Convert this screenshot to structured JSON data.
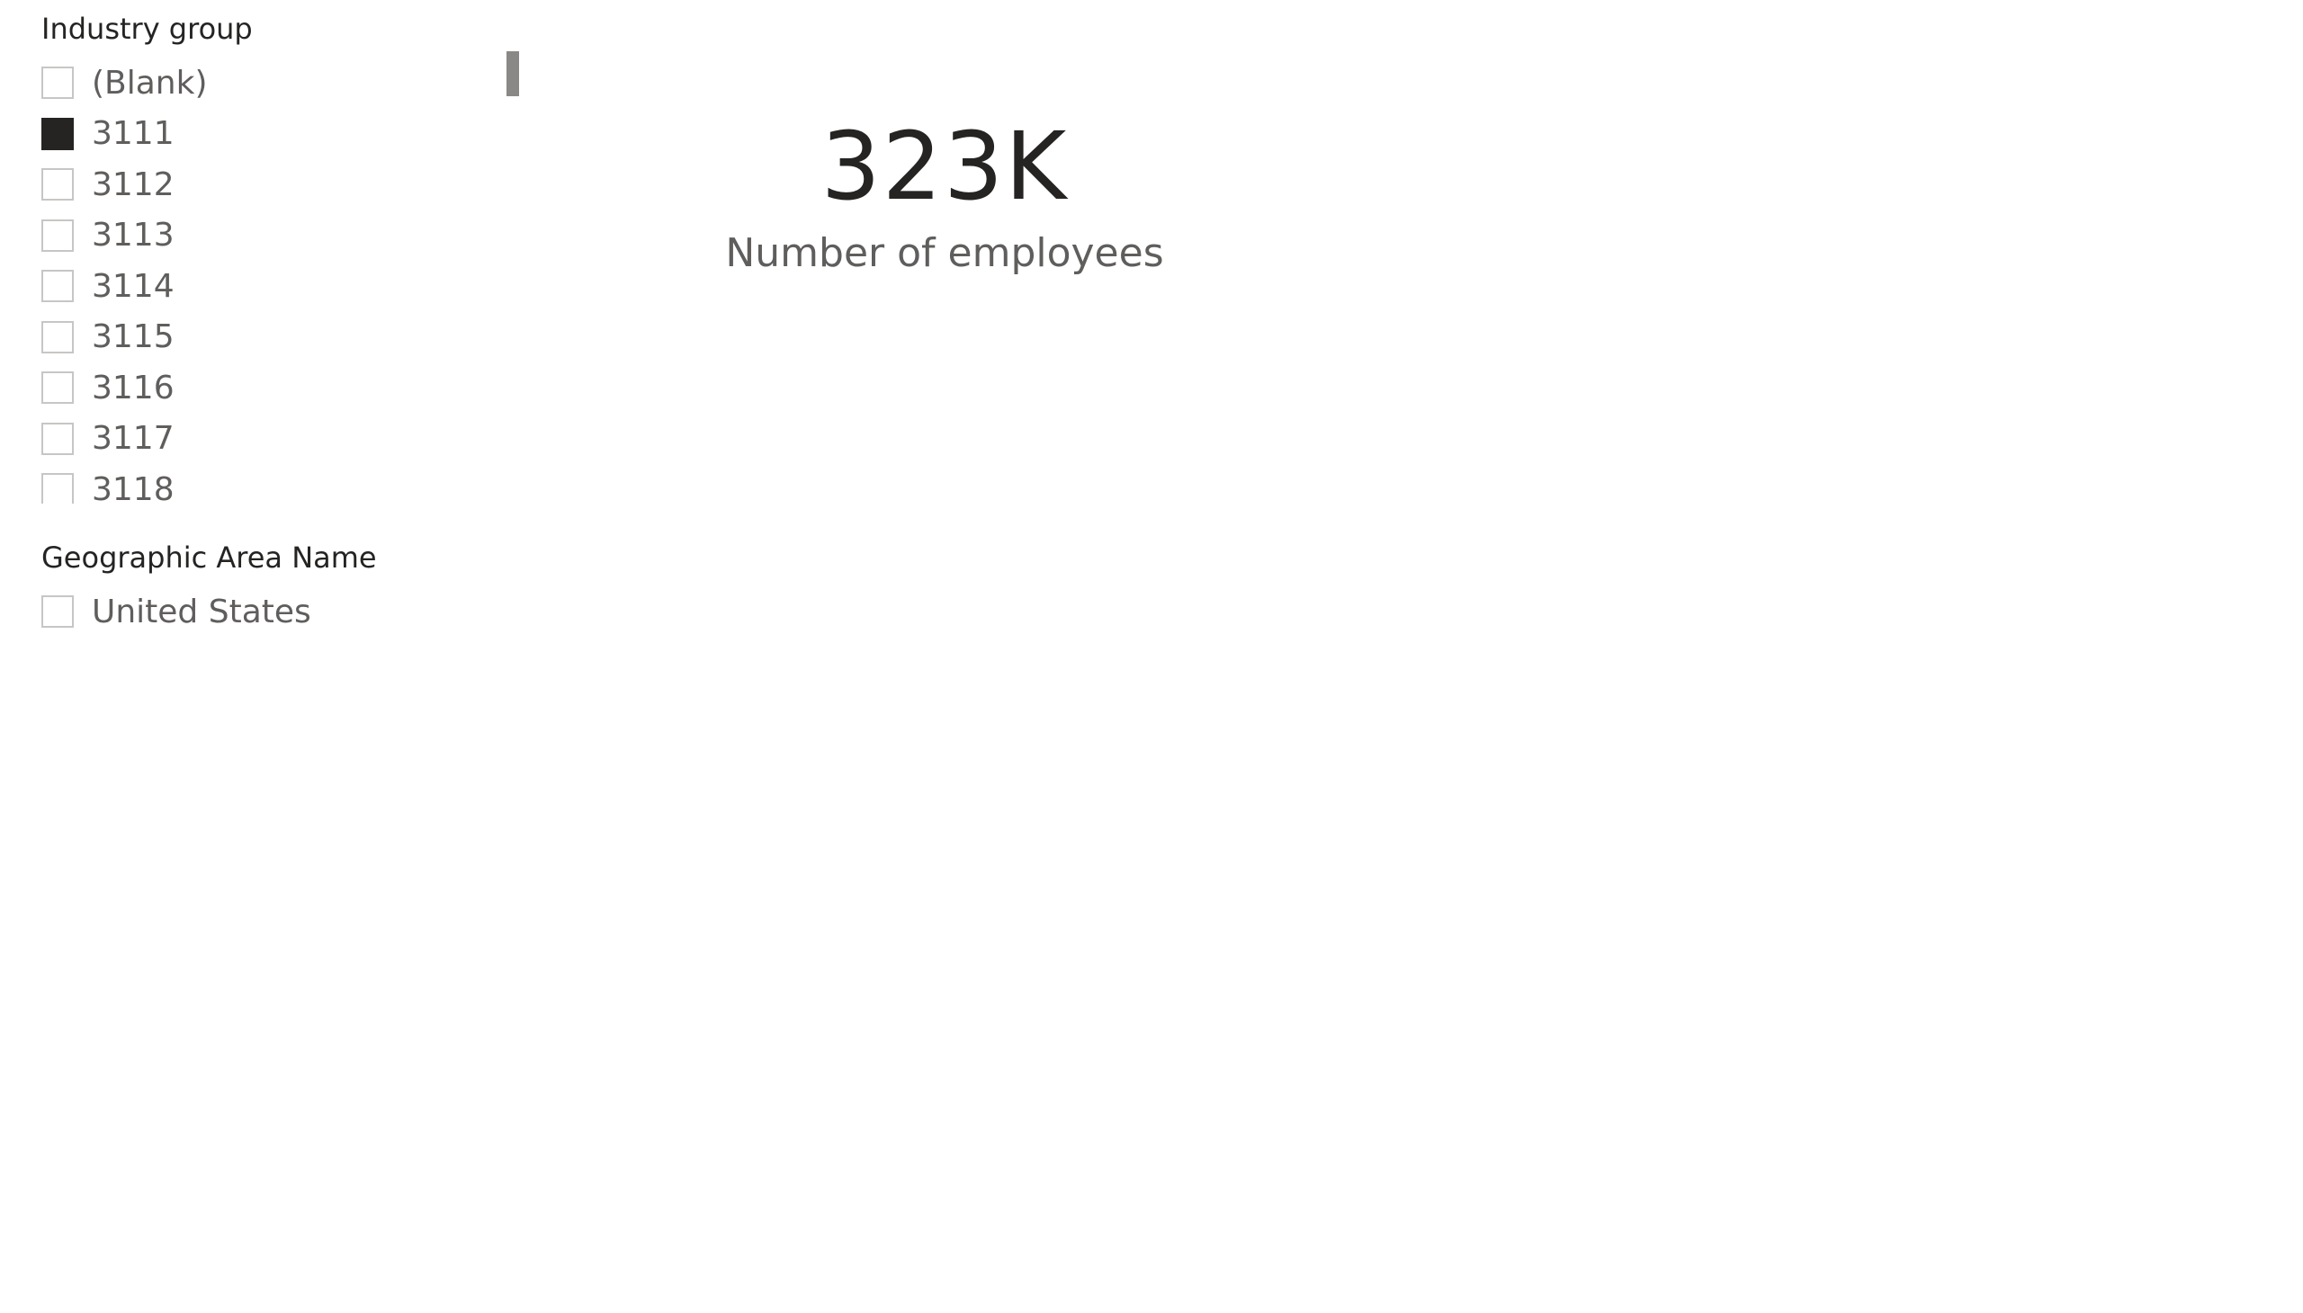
{
  "industry_slicer": {
    "title": "Industry group",
    "items": [
      {
        "label": "(Blank)",
        "checked": false
      },
      {
        "label": "3111",
        "checked": true
      },
      {
        "label": "3112",
        "checked": false
      },
      {
        "label": "3113",
        "checked": false
      },
      {
        "label": "3114",
        "checked": false
      },
      {
        "label": "3115",
        "checked": false
      },
      {
        "label": "3116",
        "checked": false
      },
      {
        "label": "3117",
        "checked": false
      },
      {
        "label": "3118",
        "checked": false
      }
    ]
  },
  "geo_slicer": {
    "title": "Geographic Area Name",
    "items": [
      {
        "label": "United States",
        "checked": false
      }
    ]
  },
  "card": {
    "value": "323K",
    "label": "Number of employees"
  },
  "colors": {
    "checked_fill": "#252423",
    "checkbox_border": "#c8c6c4",
    "label_text": "#605e5c",
    "title_text": "#252423",
    "scrollbar": "#8a8886"
  }
}
